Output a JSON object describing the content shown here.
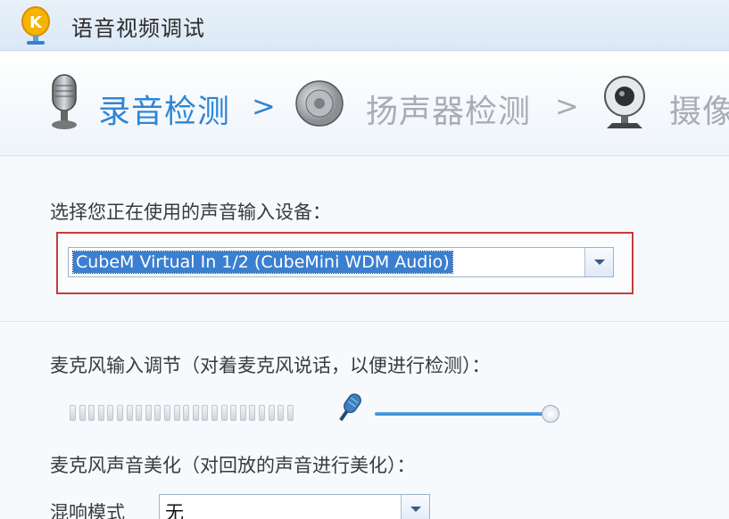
{
  "window": {
    "title": "语音视频调试"
  },
  "steps": [
    {
      "label": "录音检测",
      "arrow": ">",
      "icon": "microphone-icon",
      "active": true
    },
    {
      "label": "扬声器检测",
      "arrow": ">",
      "icon": "speaker-icon",
      "active": false
    },
    {
      "label": "摄像",
      "icon": "webcam-icon",
      "active": false
    }
  ],
  "device": {
    "label": "选择您正在使用的声音输入设备：",
    "value": "CubeM Virtual In 1/2 (CubeMini WDM Audio)"
  },
  "mic_adjust": {
    "label": "麦克风输入调节（对着麦克风说话，以便进行检测）："
  },
  "beautify": {
    "label": "麦克风声音美化（对回放的声音进行美化）：",
    "reverb_label": "混响模式",
    "reverb_value": "无"
  },
  "colors": {
    "accent": "#2e86d6",
    "inactive": "#a7adb3",
    "highlight_border": "#c93a3a"
  }
}
